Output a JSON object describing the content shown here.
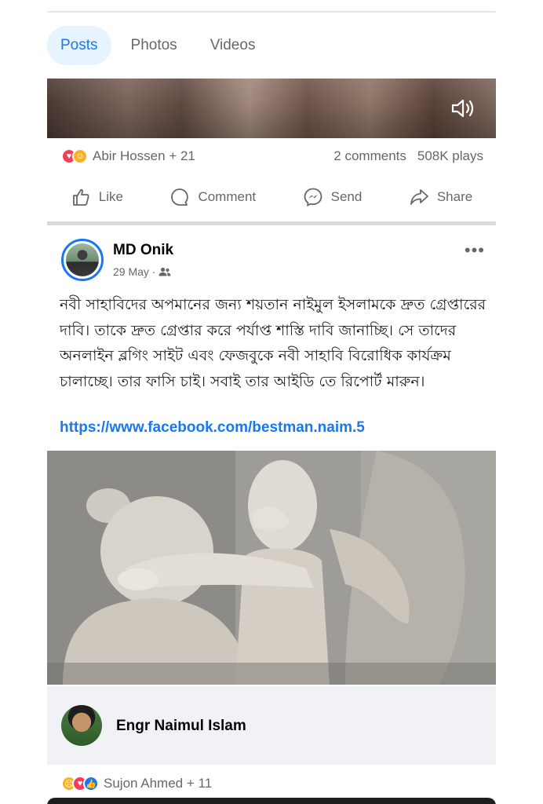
{
  "tabs": [
    {
      "label": "Posts",
      "active": true
    },
    {
      "label": "Photos",
      "active": false
    },
    {
      "label": "Videos",
      "active": false
    }
  ],
  "video_post": {
    "reactions_text": "Abir Hossen + 21",
    "comments": "2 comments",
    "plays": "508K plays",
    "reaction_icons": [
      "love-react",
      "care-react"
    ],
    "volume_icon": "speaker-icon"
  },
  "actions": {
    "like": "Like",
    "comment": "Comment",
    "send": "Send",
    "share": "Share"
  },
  "post": {
    "author": "MD Onik",
    "date": "29 May · ",
    "privacy_icon": "friends-icon",
    "text": "নবী সাহাবিদের অপমানের জন্য শয়তান নাইমুল ইসলামকে দ্রুত গ্রেপ্তারের দাবি। তাকে দ্রুত গ্রেপ্তার করে পর্যাপ্ত শাস্তি দাবি জানাচ্ছি। সে তাদের অনলাইন ব্লগিং সাইট  এবং ফেজবুকে নবী সাহাবি বিরোধিক কার্যক্রম চালাচ্ছে। তার ফাসি চাই। সবাই তার আইডি তে রিপোর্ট মারুন।",
    "link": "https://www.facebook.com/bestman.naim.5",
    "more": "•••"
  },
  "shared_from": {
    "name": "Engr Naimul Islam"
  },
  "bottom_reactions": {
    "text": "Sujon Ahmed + 11",
    "reaction_icons": [
      "sad-react",
      "love-react",
      "like-react"
    ]
  },
  "colors": {
    "accent": "#1877f2",
    "love": "#f33e58",
    "care": "#f7b125",
    "muted": "#65676b"
  }
}
